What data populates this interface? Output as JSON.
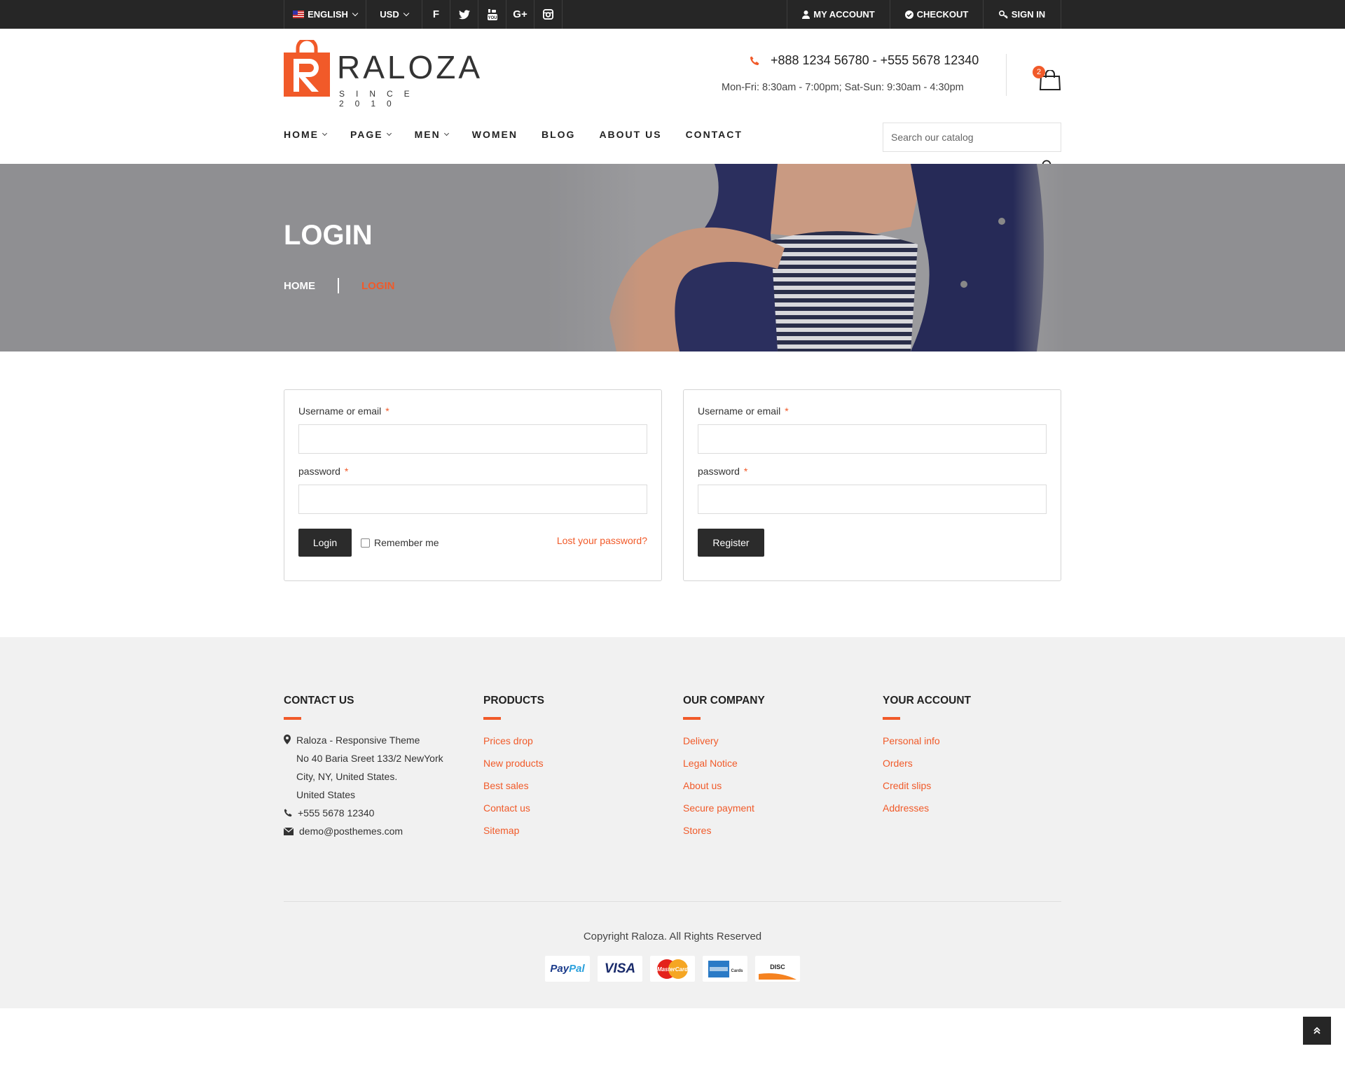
{
  "topbar": {
    "language": "ENGLISH",
    "currency": "USD",
    "social": [
      {
        "icon": "facebook-icon",
        "glyph": "f"
      },
      {
        "icon": "twitter-icon",
        "glyph": "t"
      },
      {
        "icon": "youtube-icon",
        "glyph": "▶"
      },
      {
        "icon": "google-plus-icon",
        "glyph": "G+"
      },
      {
        "icon": "instagram-icon",
        "glyph": "◙"
      }
    ],
    "my_account": "MY ACCOUNT",
    "checkout": "CHECKOUT",
    "sign_in": "SIGN IN"
  },
  "header": {
    "logo_text": "RALOZA",
    "logo_since": "SINCE 2010",
    "phone": "+888 1234 56780 - +555 5678 12340",
    "hours": "Mon-Fri: 8:30am - 7:00pm; Sat-Sun: 9:30am - 4:30pm",
    "cart_count": "2"
  },
  "nav": {
    "items": [
      "HOME",
      "PAGE",
      "MEN",
      "WOMEN",
      "BLOG",
      "ABOUT US",
      "CONTACT"
    ],
    "search_placeholder": "Search our catalog"
  },
  "banner": {
    "title": "LOGIN",
    "breadcrumb_home": "HOME",
    "breadcrumb_current": "LOGIN"
  },
  "login_form": {
    "username_label": "Username or email",
    "password_label": "password",
    "required_mark": "*",
    "login_button": "Login",
    "remember_label": "Remember me",
    "lost_password": "Lost your password?"
  },
  "register_form": {
    "username_label": "Username or email",
    "password_label": "password",
    "required_mark": "*",
    "register_button": "Register"
  },
  "footer": {
    "contact": {
      "title": "CONTACT US",
      "address_lines": [
        "Raloza - Responsive Theme",
        "No 40 Baria Sreet 133/2 NewYork",
        "City, NY, United States.",
        "United States"
      ],
      "phone": "+555 5678 12340",
      "email": "demo@posthemes.com"
    },
    "products": {
      "title": "PRODUCTS",
      "links": [
        "Prices drop",
        "New products",
        "Best sales",
        "Contact us",
        "Sitemap"
      ]
    },
    "company": {
      "title": "OUR COMPANY",
      "links": [
        "Delivery",
        "Legal Notice",
        "About us",
        "Secure payment",
        "Stores"
      ]
    },
    "account": {
      "title": "YOUR ACCOUNT",
      "links": [
        "Personal info",
        "Orders",
        "Credit slips",
        "Addresses"
      ]
    },
    "copyright": "Copyright Raloza. All Rights Reserved",
    "payments": [
      "PayPal",
      "VISA",
      "MasterCard",
      "American Express",
      "DISCOVER"
    ]
  },
  "colors": {
    "accent": "#f15a29",
    "topbar": "#262626",
    "footer_bg": "#f1f1f1"
  }
}
